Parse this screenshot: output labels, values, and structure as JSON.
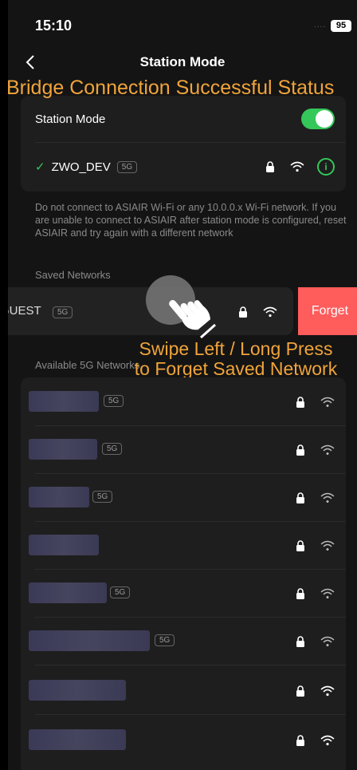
{
  "status_bar": {
    "time": "15:10",
    "battery": "95"
  },
  "nav": {
    "title": "Station Mode",
    "back_icon": "chevron-left-icon"
  },
  "banner": "Bridge Connection Successful Status",
  "station": {
    "label": "Station Mode",
    "toggle_on": true,
    "connected_network": "ZWO_DEV",
    "connected_band": "5G"
  },
  "note": "Do not connect to ASIAIR Wi-Fi or any 10.0.0.x Wi-Fi network. If you are unable to connect to ASIAIR after station mode is configured, reset ASIAIR and try again with a different network",
  "saved": {
    "label": "Saved Networks",
    "network": "GUEST",
    "band": "5G",
    "forget_label": "Forget"
  },
  "swipe_note_lines": [
    "Swipe Left / Long Press",
    "to Forget Saved Network"
  ],
  "available": {
    "label": "Available 5G Networks",
    "networks": [
      {
        "band": "5G"
      },
      {
        "band": "5G"
      },
      {
        "band": "5G"
      },
      {
        "band": ""
      },
      {
        "band": "5G"
      },
      {
        "band": "5G"
      },
      {
        "band": ""
      },
      {
        "band": ""
      }
    ]
  },
  "colors": {
    "accent_green": "#34c759",
    "forget_red": "#ff5c5c",
    "annotation_orange": "#f0a43a"
  }
}
